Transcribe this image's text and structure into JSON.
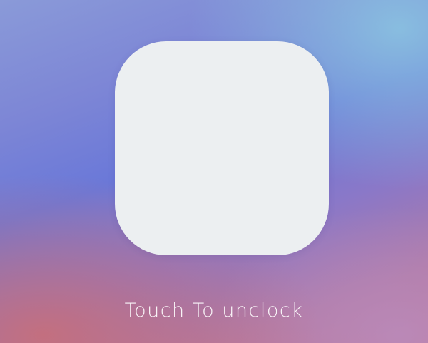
{
  "lock_screen": {
    "pad": {
      "color": "#eceff1"
    },
    "prompt": "Touch To unclock"
  },
  "colors": {
    "background_top_right": "#8cc8e1",
    "background_mid": "#6a78d8",
    "background_bottom_left": "#c86e78",
    "label_text": "#ffffff"
  }
}
